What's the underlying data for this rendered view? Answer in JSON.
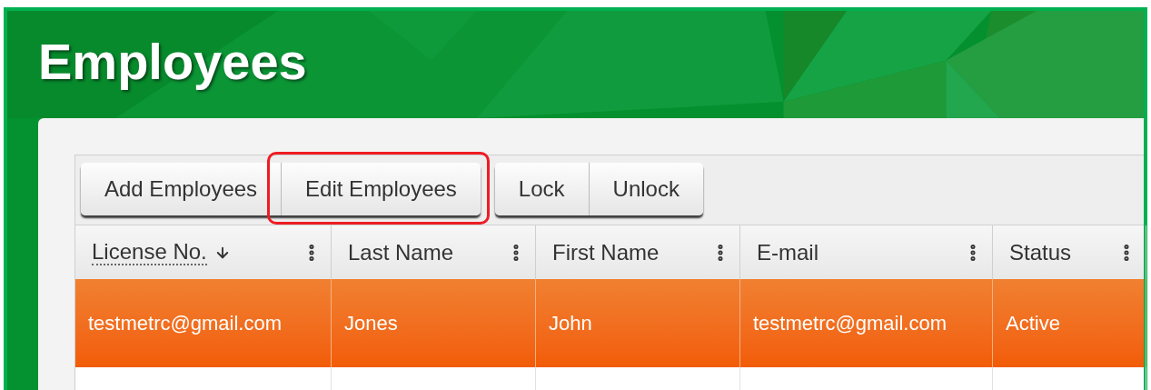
{
  "page": {
    "title": "Employees"
  },
  "toolbar": {
    "groups": [
      {
        "buttons": [
          {
            "label": "Add Employees",
            "highlighted": false
          },
          {
            "label": "Edit Employees",
            "highlighted": true
          }
        ]
      },
      {
        "buttons": [
          {
            "label": "Lock",
            "highlighted": false
          },
          {
            "label": "Unlock",
            "highlighted": false
          }
        ]
      }
    ]
  },
  "table": {
    "columns": [
      {
        "label": "License No.",
        "sorted": true
      },
      {
        "label": "Last Name",
        "sorted": false
      },
      {
        "label": "First Name",
        "sorted": false
      },
      {
        "label": "E-mail",
        "sorted": false
      },
      {
        "label": "Status",
        "sorted": false
      }
    ],
    "rows": [
      {
        "selected": true,
        "cells": [
          "testmetrc@gmail.com",
          "Jones",
          "John",
          "testmetrc@gmail.com",
          "Active"
        ]
      }
    ]
  }
}
